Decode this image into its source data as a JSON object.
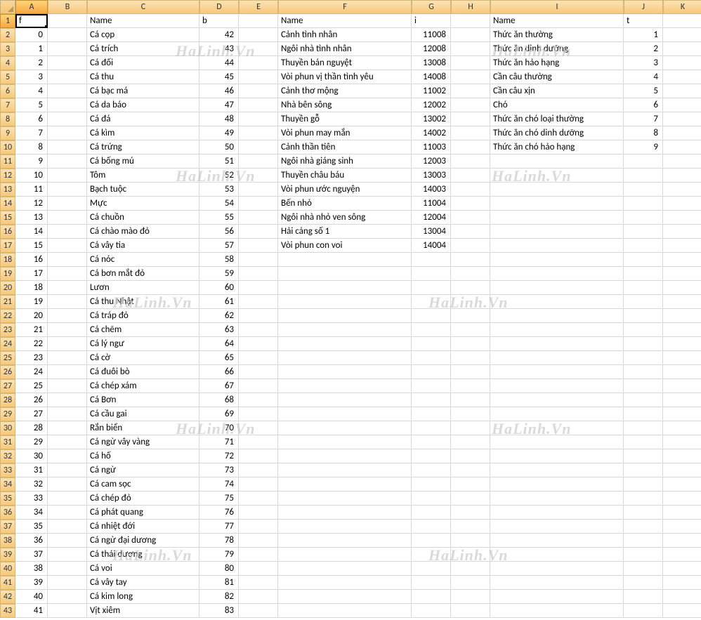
{
  "columns": [
    "A",
    "B",
    "C",
    "D",
    "E",
    "F",
    "G",
    "H",
    "I",
    "J",
    "K"
  ],
  "active_col": "A",
  "active_row": 1,
  "header_row": {
    "A": "f",
    "C": "Name",
    "D": "b",
    "F": "Name",
    "G": "i",
    "I": "Name",
    "J": "t"
  },
  "rows": [
    {
      "A": 0,
      "C": "Cá cọp",
      "D": 42,
      "F": "Cảnh tình nhân",
      "G": 11008,
      "I": "Thức ăn thường",
      "J": 1
    },
    {
      "A": 1,
      "C": "Cá trích",
      "D": 43,
      "F": "Ngôi nhà tình nhân",
      "G": 12008,
      "I": "Thức ăn dinh dưỡng",
      "J": 2
    },
    {
      "A": 2,
      "C": "Cá đối",
      "D": 44,
      "F": "Thuyền bán nguyệt",
      "G": 13008,
      "I": "Thức ăn hảo hạng",
      "J": 3
    },
    {
      "A": 3,
      "C": "Cá thu",
      "D": 45,
      "F": "Vòi phun vị thần tình yêu",
      "G": 14008,
      "I": "Cần câu thường",
      "J": 4
    },
    {
      "A": 4,
      "C": "Cá bạc má",
      "D": 46,
      "F": "Cảnh thơ mộng",
      "G": 11002,
      "I": " Cần câu xịn",
      "J": 5
    },
    {
      "A": 5,
      "C": "Cá da báo",
      "D": 47,
      "F": "Nhà bên sông",
      "G": 12002,
      "I": "Chó",
      "J": 6
    },
    {
      "A": 6,
      "C": "Cá đá",
      "D": 48,
      "F": "Thuyền gỗ",
      "G": 13002,
      "I": "Thức ăn chó loại thường",
      "J": 7
    },
    {
      "A": 7,
      "C": "Cá kìm",
      "D": 49,
      "F": "Vòi phun may mắn",
      "G": 14002,
      "I": "Thức ăn chó dinh dưỡng",
      "J": 8
    },
    {
      "A": 8,
      "C": "Cá trứng",
      "D": 50,
      "F": "Cảnh thần tiên",
      "G": 11003,
      "I": " Thức ăn chó hảo hạng",
      "J": 9
    },
    {
      "A": 9,
      "C": "Cá bống mú",
      "D": 51,
      "F": "Ngôi nhà giáng sinh",
      "G": 12003
    },
    {
      "A": 10,
      "C": "Tôm",
      "D": 52,
      "F": "Thuyền châu báu",
      "G": 13003
    },
    {
      "A": 11,
      "C": "Bạch tuộc",
      "D": 53,
      "F": "Vòi phun ước nguyện",
      "G": 14003
    },
    {
      "A": 12,
      "C": "Mực",
      "D": 54,
      "F": " Bến nhỏ",
      "G": 11004
    },
    {
      "A": 13,
      "C": "Cá chuồn",
      "D": 55,
      "F": " Ngôi nhà nhỏ ven sông",
      "G": 12004
    },
    {
      "A": 14,
      "C": "Cá chào mào đỏ",
      "D": 56,
      "F": "Hải cảng số 1",
      "G": 13004
    },
    {
      "A": 15,
      "C": "Cá vây tia",
      "D": 57,
      "F": "Vòi phun con voi",
      "G": 14004
    },
    {
      "A": 16,
      "C": "Cá nóc",
      "D": 58
    },
    {
      "A": 17,
      "C": "Cá bơn mắt đỏ",
      "D": 59
    },
    {
      "A": 18,
      "C": "Lươn",
      "D": 60
    },
    {
      "A": 19,
      "C": "Cá thu Nhật",
      "D": 61
    },
    {
      "A": 20,
      "C": "Cá tráp đỏ",
      "D": 62
    },
    {
      "A": 21,
      "C": "Cá chẽm",
      "D": 63
    },
    {
      "A": 22,
      "C": "Cá lý ngư",
      "D": 64
    },
    {
      "A": 23,
      "C": "Cá cờ",
      "D": 65
    },
    {
      "A": 24,
      "C": "Cá đuôi bò",
      "D": 66
    },
    {
      "A": 25,
      "C": "Cá chép xám",
      "D": 67
    },
    {
      "A": 26,
      "C": "Cá Bơn",
      "D": 68
    },
    {
      "A": 27,
      "C": "Cá cầu gai",
      "D": 69
    },
    {
      "A": 28,
      "C": "Rắn biển",
      "D": 70
    },
    {
      "A": 29,
      "C": "Cá ngừ vây vàng",
      "D": 71
    },
    {
      "A": 30,
      "C": "Cá hố",
      "D": 72
    },
    {
      "A": 31,
      "C": "Cá ngừ",
      "D": 73
    },
    {
      "A": 32,
      "C": "Cá cam sọc",
      "D": 74
    },
    {
      "A": 33,
      "C": "Cá chép đỏ",
      "D": 75
    },
    {
      "A": 34,
      "C": "Cá phát quang",
      "D": 76
    },
    {
      "A": 35,
      "C": "Cá nhiệt đới",
      "D": 77
    },
    {
      "A": 36,
      "C": "Cá ngừ đại dương",
      "D": 78
    },
    {
      "A": 37,
      "C": "Cá thái dương",
      "D": 79
    },
    {
      "A": 38,
      "C": "Cá voi",
      "D": 80
    },
    {
      "A": 39,
      "C": "Cá vây tay",
      "D": 81
    },
    {
      "A": 40,
      "C": "Cá kim long",
      "D": 82
    },
    {
      "A": 41,
      "C": "Vịt xiêm",
      "D": 83
    }
  ],
  "watermark": "HaLinh.Vn",
  "num_columns": [
    "A",
    "D",
    "G",
    "J"
  ]
}
